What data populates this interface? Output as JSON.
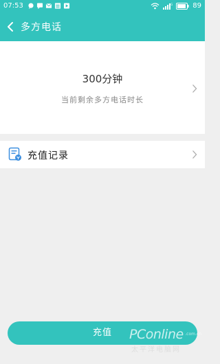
{
  "status_bar": {
    "time": "07:53",
    "battery": "89",
    "left_icons": [
      "chat-icon",
      "message-icon",
      "mail-icon",
      "list-icon",
      "play-icon"
    ],
    "right_icons": [
      "wifi-icon",
      "signal-icon",
      "battery-icon"
    ]
  },
  "nav": {
    "title": "多方电话"
  },
  "balance": {
    "minutes": "300分钟",
    "description": "当前剩余多方电话时长"
  },
  "records": {
    "label": "充值记录"
  },
  "actions": {
    "recharge_label": "充值"
  },
  "watermark": {
    "logo": "PConline",
    "sub": "太平洋电脑网",
    "small": ".com.cn"
  },
  "colors": {
    "brand": "#33c3bd",
    "background": "#efefef"
  }
}
